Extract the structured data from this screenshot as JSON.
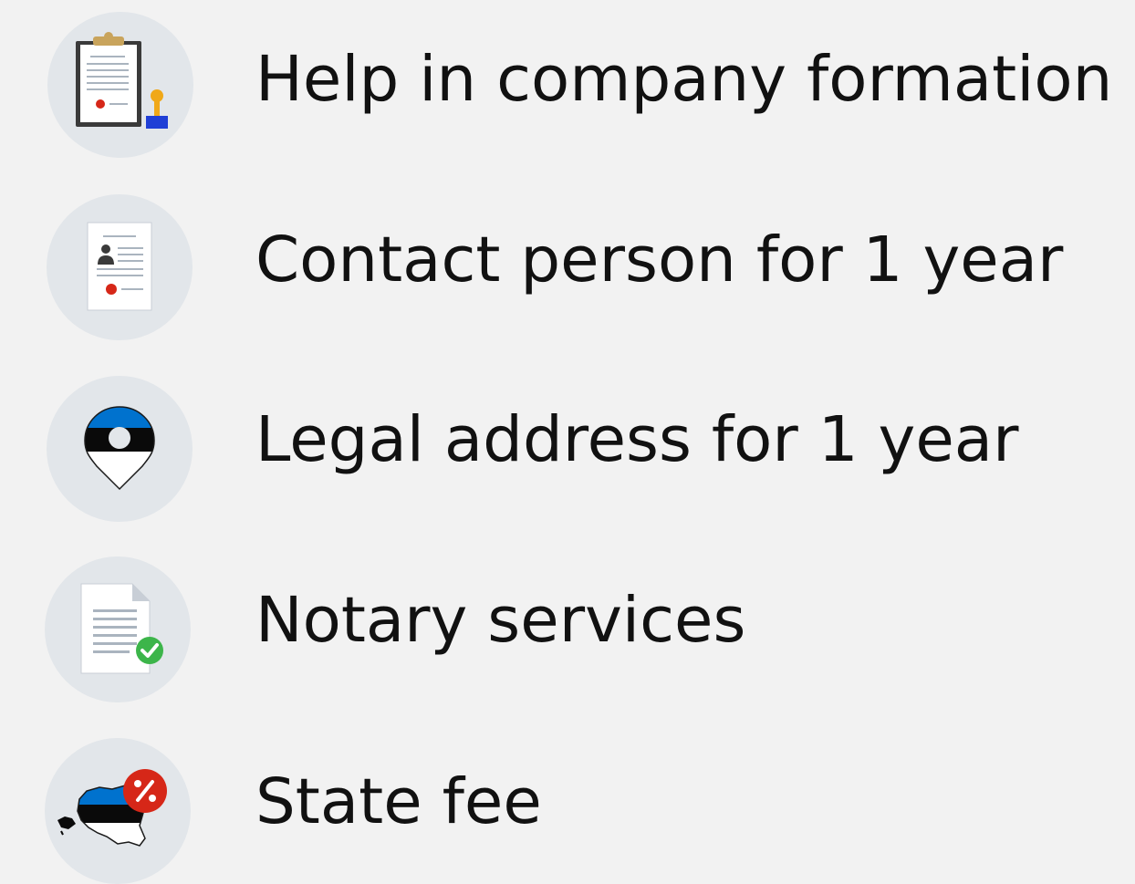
{
  "colors": {
    "background": "#f2f2f2",
    "icon_circle": "#e2e6ea",
    "text": "#111111",
    "estonia_blue": "#0072ce",
    "accent_red": "#d62718",
    "check_green": "#3cb54a"
  },
  "items": [
    {
      "label": "Help in company formation",
      "icon": "clipboard-stamp-icon"
    },
    {
      "label": "Contact person for 1 year",
      "icon": "contact-card-icon"
    },
    {
      "label": "Legal address for 1 year",
      "icon": "estonia-location-pin-icon"
    },
    {
      "label": "Notary services",
      "icon": "document-check-icon"
    },
    {
      "label": "State fee",
      "icon": "estonia-map-percent-icon"
    }
  ]
}
